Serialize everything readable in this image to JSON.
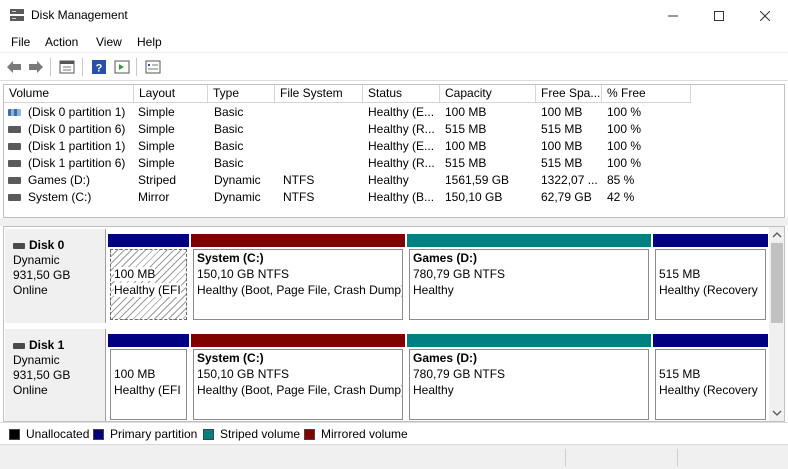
{
  "window": {
    "title": "Disk Management"
  },
  "menu": [
    "File",
    "Action",
    "View",
    "Help"
  ],
  "toolbar": {
    "icons": [
      "back-arrow-icon",
      "forward-arrow-icon",
      "properties-icon",
      "help-icon",
      "refresh-icon",
      "settings-icon"
    ]
  },
  "volume_list": {
    "columns": [
      "Volume",
      "Layout",
      "Type",
      "File System",
      "Status",
      "Capacity",
      "Free Spa...",
      "% Free"
    ],
    "rows": [
      {
        "volume": "(Disk 0 partition 1)",
        "layout": "Simple",
        "type": "Basic",
        "fs": "",
        "status": "Healthy (E...",
        "capacity": "100 MB",
        "free": "100 MB",
        "pct": "100 %",
        "icon": "striped"
      },
      {
        "volume": "(Disk 0 partition 6)",
        "layout": "Simple",
        "type": "Basic",
        "fs": "",
        "status": "Healthy (R...",
        "capacity": "515 MB",
        "free": "515 MB",
        "pct": "100 %",
        "icon": "plain"
      },
      {
        "volume": "(Disk 1 partition 1)",
        "layout": "Simple",
        "type": "Basic",
        "fs": "",
        "status": "Healthy (E...",
        "capacity": "100 MB",
        "free": "100 MB",
        "pct": "100 %",
        "icon": "plain"
      },
      {
        "volume": "(Disk 1 partition 6)",
        "layout": "Simple",
        "type": "Basic",
        "fs": "",
        "status": "Healthy (R...",
        "capacity": "515 MB",
        "free": "515 MB",
        "pct": "100 %",
        "icon": "plain"
      },
      {
        "volume": "Games (D:)",
        "layout": "Striped",
        "type": "Dynamic",
        "fs": "NTFS",
        "status": "Healthy",
        "capacity": "1561,59 GB",
        "free": "1322,07 ...",
        "pct": "85 %",
        "icon": "plain"
      },
      {
        "volume": "System (C:)",
        "layout": "Mirror",
        "type": "Dynamic",
        "fs": "NTFS",
        "status": "Healthy (B...",
        "capacity": "150,10 GB",
        "free": "62,79 GB",
        "pct": "42 %",
        "icon": "plain"
      }
    ]
  },
  "disks": [
    {
      "name": "Disk 0",
      "type": "Dynamic",
      "size": "931,50 GB",
      "state": "Online",
      "partitions": [
        {
          "name": "",
          "size": "100 MB",
          "status": "Healthy (EFI",
          "kind": "primary",
          "hatched": true
        },
        {
          "name": "System  (C:)",
          "size": "150,10 GB NTFS",
          "status": "Healthy (Boot, Page File, Crash Dump)",
          "kind": "mirrored",
          "hatched": false
        },
        {
          "name": "Games  (D:)",
          "size": "780,79 GB NTFS",
          "status": "Healthy",
          "kind": "striped",
          "hatched": false
        },
        {
          "name": "",
          "size": "515 MB",
          "status": "Healthy (Recovery",
          "kind": "primary",
          "hatched": false
        }
      ]
    },
    {
      "name": "Disk 1",
      "type": "Dynamic",
      "size": "931,50 GB",
      "state": "Online",
      "partitions": [
        {
          "name": "",
          "size": "100 MB",
          "status": "Healthy (EFI",
          "kind": "primary",
          "hatched": false
        },
        {
          "name": "System  (C:)",
          "size": "150,10 GB NTFS",
          "status": "Healthy (Boot, Page File, Crash Dump)",
          "kind": "mirrored",
          "hatched": false
        },
        {
          "name": "Games  (D:)",
          "size": "780,79 GB NTFS",
          "status": "Healthy",
          "kind": "striped",
          "hatched": false
        },
        {
          "name": "",
          "size": "515 MB",
          "status": "Healthy (Recovery",
          "kind": "primary",
          "hatched": false
        }
      ]
    }
  ],
  "legend": [
    {
      "label": "Unallocated",
      "color": "#000000"
    },
    {
      "label": "Primary partition",
      "color": "#000080"
    },
    {
      "label": "Striped volume",
      "color": "#008080"
    },
    {
      "label": "Mirrored volume",
      "color": "#800000"
    }
  ],
  "colors": {
    "primary": "#000080",
    "striped": "#008080",
    "mirrored": "#800000",
    "unallocated": "#000000"
  }
}
